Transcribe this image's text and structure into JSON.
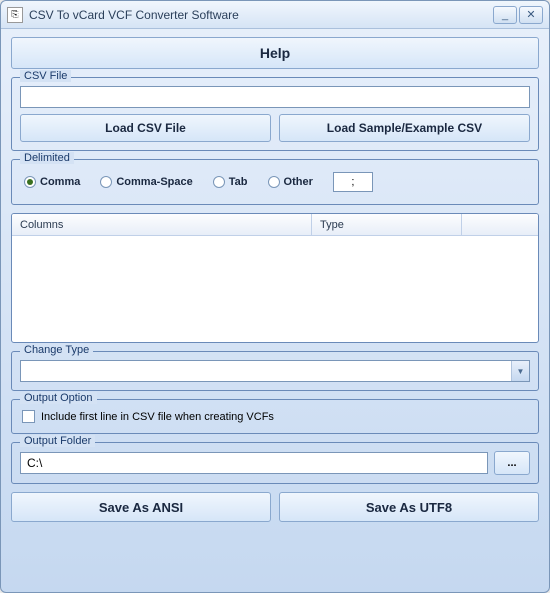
{
  "window": {
    "title": "CSV To vCard VCF Converter Software"
  },
  "help": {
    "label": "Help"
  },
  "csv_file": {
    "legend": "CSV File",
    "path": "",
    "load_btn": "Load CSV File",
    "sample_btn": "Load Sample/Example CSV"
  },
  "delimited": {
    "legend": "Delimited",
    "options": {
      "comma": "Comma",
      "comma_space": "Comma-Space",
      "tab": "Tab",
      "other": "Other"
    },
    "selected": "comma",
    "other_value": ";"
  },
  "table": {
    "headers": {
      "columns": "Columns",
      "type": "Type"
    }
  },
  "change_type": {
    "legend": "Change Type",
    "value": ""
  },
  "output_option": {
    "legend": "Output Option",
    "include_first_line": "Include first line in CSV file when creating VCFs",
    "checked": false
  },
  "output_folder": {
    "legend": "Output Folder",
    "path": "C:\\",
    "browse": "..."
  },
  "save": {
    "ansi": "Save As ANSI",
    "utf8": "Save As UTF8"
  }
}
